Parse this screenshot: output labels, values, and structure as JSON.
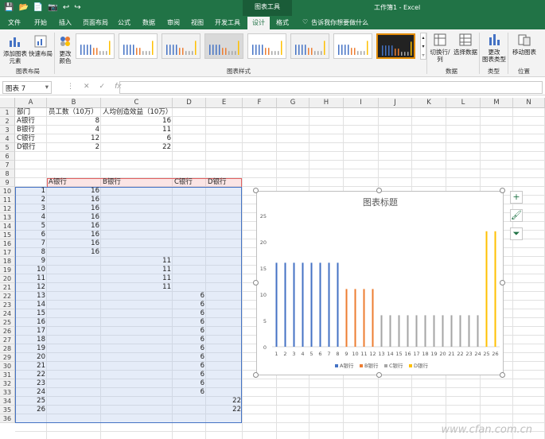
{
  "qat": [
    "💾",
    "📂",
    "📄",
    "📷",
    "↩",
    "↪"
  ],
  "context_tab": "图表工具",
  "doc_title": "工作簿1 - Excel",
  "tabs": [
    "文件",
    "开始",
    "插入",
    "页面布局",
    "公式",
    "数据",
    "审阅",
    "视图",
    "开发工具",
    "设计",
    "格式"
  ],
  "tell_me": "告诉我你想要做什么",
  "ribbon": {
    "add_element": "添加图表\n元素",
    "quick_layout": "快速布局",
    "change_color": "更改\n颜色",
    "switch_rowcol": "切换行/列",
    "select_data": "选择数据",
    "change_type": "更改\n图表类型",
    "move_chart": "移动图表",
    "groups": [
      "图表布局",
      "图表样式",
      "数据",
      "类型",
      "位置"
    ]
  },
  "name_box": "图表 7",
  "formula_icons": [
    "⋮",
    "✕",
    "✓",
    "fx"
  ],
  "columns": [
    "A",
    "B",
    "C",
    "D",
    "E",
    "F",
    "G",
    "H",
    "I",
    "J",
    "K",
    "L",
    "M",
    "N"
  ],
  "rows": [
    "1",
    "2",
    "3",
    "4",
    "5",
    "6",
    "7",
    "8",
    "9",
    "10",
    "11",
    "12",
    "13",
    "14",
    "15",
    "16",
    "17",
    "18",
    "19",
    "20",
    "21",
    "22",
    "23",
    "24",
    "25",
    "26",
    "27",
    "28",
    "29",
    "30",
    "31",
    "32",
    "33",
    "34",
    "35",
    "36"
  ],
  "table": {
    "h1": "部门",
    "h2": "员工数（10万）",
    "h3": "人均创造效益（10万）",
    "rows": [
      [
        "A银行",
        "8",
        "16"
      ],
      [
        "B银行",
        "4",
        "11"
      ],
      [
        "C银行",
        "12",
        "6"
      ],
      [
        "D银行",
        "2",
        "22"
      ]
    ]
  },
  "headers9": [
    "A银行",
    "B银行",
    "C银行",
    "D银行"
  ],
  "data_index": [
    "1",
    "2",
    "3",
    "4",
    "5",
    "6",
    "7",
    "8",
    "9",
    "10",
    "11",
    "12",
    "13",
    "14",
    "15",
    "16",
    "17",
    "18",
    "19",
    "20",
    "21",
    "22",
    "23",
    "24",
    "25",
    "26"
  ],
  "data_values": [
    "16",
    "16",
    "16",
    "16",
    "16",
    "16",
    "16",
    "16",
    "11",
    "11",
    "11",
    "11",
    "6",
    "6",
    "6",
    "6",
    "6",
    "6",
    "6",
    "6",
    "6",
    "6",
    "6",
    "6",
    "22",
    "22"
  ],
  "chart_side": [
    "+",
    "🖌",
    "⏷"
  ],
  "watermark": "www.cfan.com.cn",
  "chart_data": {
    "type": "bar",
    "title": "图表标题",
    "categories": [
      "1",
      "2",
      "3",
      "4",
      "5",
      "6",
      "7",
      "8",
      "9",
      "10",
      "11",
      "12",
      "13",
      "14",
      "15",
      "16",
      "17",
      "18",
      "19",
      "20",
      "21",
      "22",
      "23",
      "24",
      "25",
      "26"
    ],
    "ylim": [
      0,
      25
    ],
    "yticks": [
      "0",
      "5",
      "10",
      "15",
      "20",
      "25"
    ],
    "series": [
      {
        "name": "A银行",
        "color": "#4472c4",
        "values": [
          16,
          16,
          16,
          16,
          16,
          16,
          16,
          16,
          0,
          0,
          0,
          0,
          0,
          0,
          0,
          0,
          0,
          0,
          0,
          0,
          0,
          0,
          0,
          0,
          0,
          0
        ]
      },
      {
        "name": "B银行",
        "color": "#ed7d31",
        "values": [
          0,
          0,
          0,
          0,
          0,
          0,
          0,
          0,
          11,
          11,
          11,
          11,
          0,
          0,
          0,
          0,
          0,
          0,
          0,
          0,
          0,
          0,
          0,
          0,
          0,
          0
        ]
      },
      {
        "name": "C银行",
        "color": "#a5a5a5",
        "values": [
          0,
          0,
          0,
          0,
          0,
          0,
          0,
          0,
          0,
          0,
          0,
          0,
          6,
          6,
          6,
          6,
          6,
          6,
          6,
          6,
          6,
          6,
          6,
          6,
          0,
          0
        ]
      },
      {
        "name": "D银行",
        "color": "#ffc000",
        "values": [
          0,
          0,
          0,
          0,
          0,
          0,
          0,
          0,
          0,
          0,
          0,
          0,
          0,
          0,
          0,
          0,
          0,
          0,
          0,
          0,
          0,
          0,
          0,
          0,
          22,
          22
        ]
      }
    ],
    "grid": false,
    "legend_position": "bottom"
  }
}
